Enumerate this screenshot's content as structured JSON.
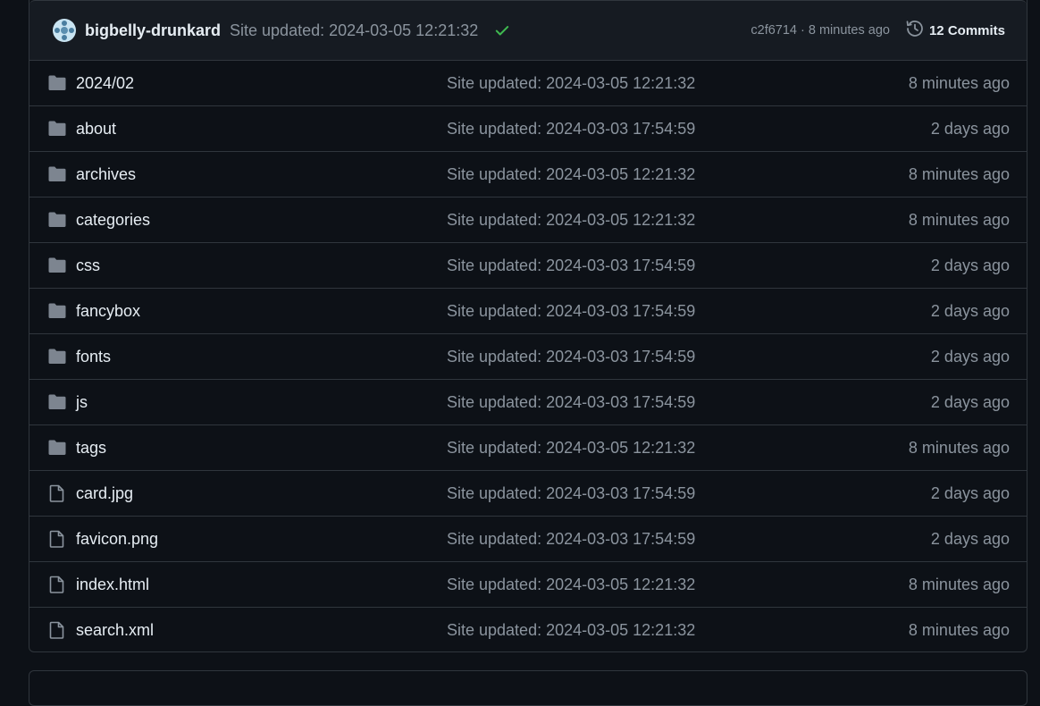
{
  "commit_bar": {
    "author": "bigbelly-drunkard",
    "message": "Site updated: 2024-03-05 12:21:32",
    "sha_time": "c2f6714 · 8 minutes ago",
    "commits_label": "12 Commits"
  },
  "files": [
    {
      "name": "2024/02",
      "type": "folder",
      "message": "Site updated: 2024-03-05 12:21:32",
      "age": "8 minutes ago"
    },
    {
      "name": "about",
      "type": "folder",
      "message": "Site updated: 2024-03-03 17:54:59",
      "age": "2 days ago"
    },
    {
      "name": "archives",
      "type": "folder",
      "message": "Site updated: 2024-03-05 12:21:32",
      "age": "8 minutes ago"
    },
    {
      "name": "categories",
      "type": "folder",
      "message": "Site updated: 2024-03-05 12:21:32",
      "age": "8 minutes ago"
    },
    {
      "name": "css",
      "type": "folder",
      "message": "Site updated: 2024-03-03 17:54:59",
      "age": "2 days ago"
    },
    {
      "name": "fancybox",
      "type": "folder",
      "message": "Site updated: 2024-03-03 17:54:59",
      "age": "2 days ago"
    },
    {
      "name": "fonts",
      "type": "folder",
      "message": "Site updated: 2024-03-03 17:54:59",
      "age": "2 days ago"
    },
    {
      "name": "js",
      "type": "folder",
      "message": "Site updated: 2024-03-03 17:54:59",
      "age": "2 days ago"
    },
    {
      "name": "tags",
      "type": "folder",
      "message": "Site updated: 2024-03-05 12:21:32",
      "age": "8 minutes ago"
    },
    {
      "name": "card.jpg",
      "type": "file",
      "message": "Site updated: 2024-03-03 17:54:59",
      "age": "2 days ago"
    },
    {
      "name": "favicon.png",
      "type": "file",
      "message": "Site updated: 2024-03-03 17:54:59",
      "age": "2 days ago"
    },
    {
      "name": "index.html",
      "type": "file",
      "message": "Site updated: 2024-03-05 12:21:32",
      "age": "8 minutes ago"
    },
    {
      "name": "search.xml",
      "type": "file",
      "message": "Site updated: 2024-03-05 12:21:32",
      "age": "8 minutes ago"
    }
  ],
  "colors": {
    "background": "#0d1117",
    "header_bg": "#161b22",
    "border": "#30363d",
    "text": "#e6edf3",
    "muted": "#8b949e",
    "success": "#3fb950",
    "folder_icon": "#7d8590"
  },
  "icons": {
    "folder": "folder-icon",
    "file": "file-icon",
    "check": "check-icon",
    "history": "history-icon",
    "avatar": "avatar-icon"
  }
}
